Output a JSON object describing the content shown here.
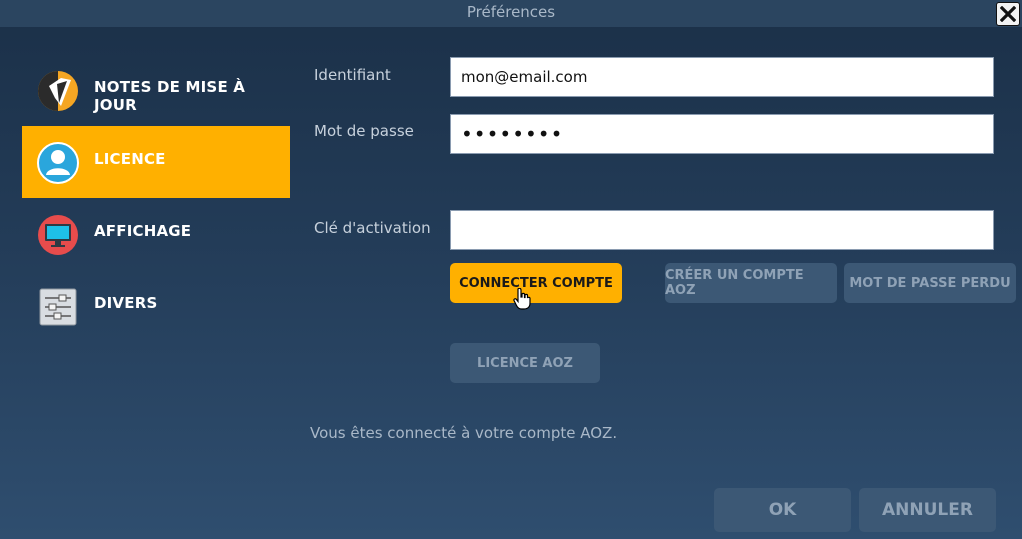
{
  "window": {
    "title": "Préférences"
  },
  "sidebar": {
    "items": [
      {
        "label": "NOTES DE MISE À JOUR",
        "icon": "release-notes-icon"
      },
      {
        "label": "LICENCE",
        "icon": "user-license-icon",
        "active": true
      },
      {
        "label": "AFFICHAGE",
        "icon": "monitor-icon"
      },
      {
        "label": "DIVERS",
        "icon": "sliders-icon"
      }
    ]
  },
  "form": {
    "identifier": {
      "label": "Identifiant",
      "value": "mon@email.com"
    },
    "password": {
      "label": "Mot de passe",
      "value": "••••••••"
    },
    "activation_key": {
      "label": "Clé d'activation",
      "value": ""
    }
  },
  "buttons": {
    "connect": "CONNECTER COMPTE",
    "create_account": "CRÉER UN COMPTE AOZ",
    "lost_password": "MOT DE PASSE PERDU",
    "aoz_licence": "LICENCE AOZ",
    "ok": "OK",
    "cancel": "ANNULER"
  },
  "status": {
    "message": "Vous êtes connecté à votre compte AOZ."
  },
  "colors": {
    "accent": "#ffb000",
    "muted_button": "#3c5875",
    "background": "#233c58"
  }
}
